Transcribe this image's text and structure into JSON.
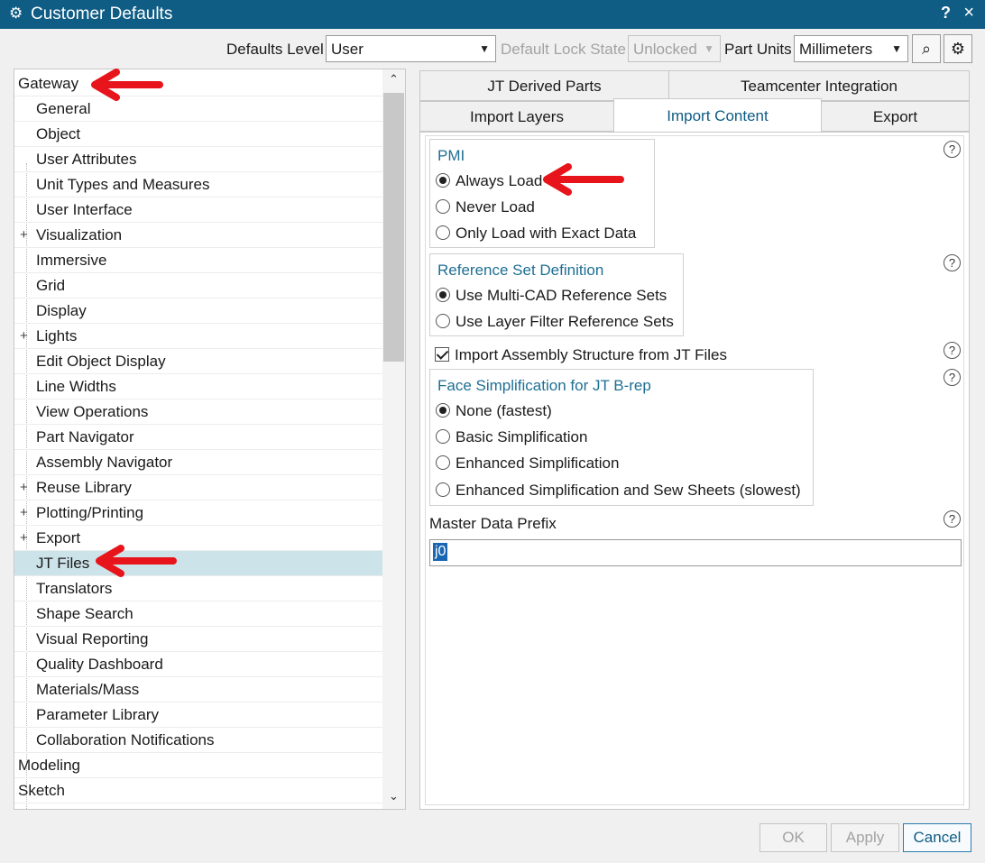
{
  "window": {
    "title": "Customer Defaults",
    "help": "?",
    "close": "×",
    "gear": "⚙"
  },
  "toolbar": {
    "defaults_level_label": "Defaults Level",
    "defaults_level_value": "User",
    "lock_state_label": "Default Lock State",
    "lock_state_value": "Unlocked",
    "part_units_label": "Part Units",
    "part_units_value": "Millimeters",
    "search_icon": "⌕",
    "settings_icon": "⚙"
  },
  "tree": {
    "items": [
      {
        "label": "Gateway",
        "level": 0
      },
      {
        "label": "General",
        "level": 1
      },
      {
        "label": "Object",
        "level": 1
      },
      {
        "label": "User Attributes",
        "level": 1
      },
      {
        "label": "Unit Types and Measures",
        "level": 1
      },
      {
        "label": "User Interface",
        "level": 1
      },
      {
        "label": "Visualization",
        "level": 1,
        "expandable": true
      },
      {
        "label": "Immersive",
        "level": 1
      },
      {
        "label": "Grid",
        "level": 1
      },
      {
        "label": "Display",
        "level": 1
      },
      {
        "label": "Lights",
        "level": 1,
        "expandable": true
      },
      {
        "label": "Edit Object Display",
        "level": 1
      },
      {
        "label": "Line Widths",
        "level": 1
      },
      {
        "label": "View Operations",
        "level": 1
      },
      {
        "label": "Part Navigator",
        "level": 1
      },
      {
        "label": "Assembly Navigator",
        "level": 1
      },
      {
        "label": "Reuse Library",
        "level": 1,
        "expandable": true
      },
      {
        "label": "Plotting/Printing",
        "level": 1,
        "expandable": true
      },
      {
        "label": "Export",
        "level": 1,
        "expandable": true
      },
      {
        "label": "JT Files",
        "level": 1,
        "selected": true
      },
      {
        "label": "Translators",
        "level": 1
      },
      {
        "label": "Shape Search",
        "level": 1
      },
      {
        "label": "Visual Reporting",
        "level": 1
      },
      {
        "label": "Quality Dashboard",
        "level": 1
      },
      {
        "label": "Materials/Mass",
        "level": 1
      },
      {
        "label": "Parameter Library",
        "level": 1
      },
      {
        "label": "Collaboration Notifications",
        "level": 1
      },
      {
        "label": "Modeling",
        "level": 0
      },
      {
        "label": "Sketch",
        "level": 0
      }
    ],
    "expand_glyph": "+",
    "scroll_up": "⌃",
    "scroll_down": "⌄"
  },
  "tabs": {
    "row1": [
      "JT Derived Parts",
      "Teamcenter Integration"
    ],
    "row2": [
      "Import Layers",
      "Import Content",
      "Export"
    ],
    "active": "Import Content"
  },
  "pmi": {
    "title": "PMI",
    "options": [
      "Always Load",
      "Never Load",
      "Only Load with Exact Data"
    ],
    "selected": 0
  },
  "refset": {
    "title": "Reference Set Definition",
    "options": [
      "Use Multi-CAD Reference Sets",
      "Use Layer Filter Reference Sets"
    ],
    "selected": 0
  },
  "import_assembly": {
    "label": "Import Assembly Structure from JT Files",
    "checked": true
  },
  "face_simplification": {
    "title": "Face Simplification for JT B-rep",
    "options": [
      "None (fastest)",
      "Basic Simplification",
      "Enhanced Simplification",
      "Enhanced Simplification and Sew Sheets (slowest)"
    ],
    "selected": 0
  },
  "master_prefix": {
    "label": "Master Data Prefix",
    "value": "j0"
  },
  "help_glyph": "?",
  "buttons": {
    "ok": "OK",
    "apply": "Apply",
    "cancel": "Cancel"
  },
  "colors": {
    "titlebar": "#0f5c85",
    "accent": "#1f6f93",
    "annotation": "#e8141b",
    "selection": "#cde3ea"
  }
}
